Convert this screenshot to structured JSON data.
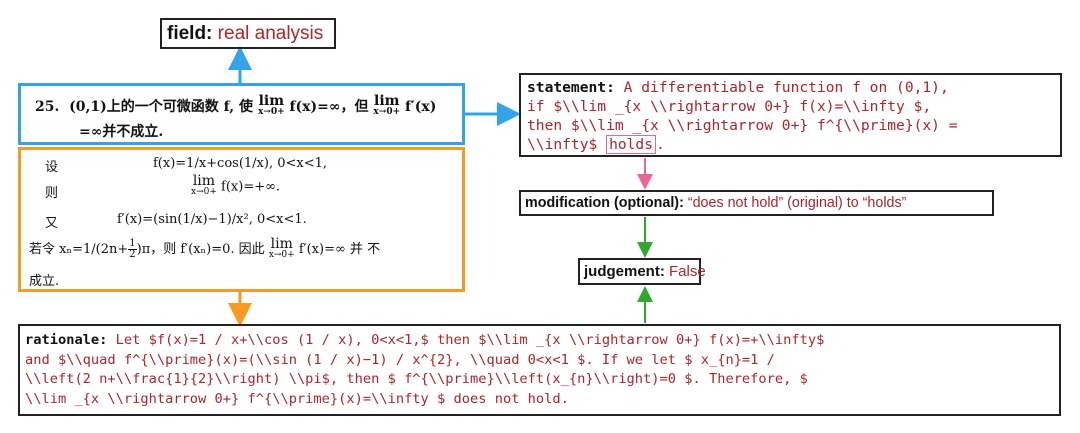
{
  "field": {
    "label": "field:",
    "value": "real analysis"
  },
  "problem": {
    "number": "25.",
    "line1_a": "(0,1)上的一个可微函数 f, 使",
    "lim1_top": "lim",
    "lim1_sub": "x→0+",
    "line1_b": "f(x)=∞，但",
    "lim2_top": "lim",
    "lim2_sub": "x→0+",
    "line1_c": "f′(x)",
    "line2": "=∞并不成立."
  },
  "solution": {
    "r1_word": "设",
    "r1_expr": "f(x)=1/x+cos(1/x), 0<x<1,",
    "r2_word": "则",
    "r2_lim": "lim",
    "r2_sub": "x→0+",
    "r2_expr": "f(x)=+∞.",
    "r3_word": "又",
    "r3_expr": "f′(x)=(sin(1/x)−1)/x²,   0<x<1.",
    "r4_a": "若令 xₙ=1/(2n+",
    "r4_frac_n": "1",
    "r4_frac_d": "2",
    "r4_b": ")π，则 f′(xₙ)=0. 因此",
    "r4_lim": "lim",
    "r4_sub": "x→0+",
    "r4_c": "f′(x)=∞ 并 不",
    "r5": "成立."
  },
  "statement": {
    "label": "statement:",
    "line1": " A differentiable function f on (0,1),",
    "line2": "if $\\\\lim _{x \\\\rightarrow 0+} f(x)=\\\\infty $,",
    "line3": "then $\\\\lim _{x \\\\rightarrow 0+} f^{\\\\prime}(x) =",
    "line4_a": "\\\\infty$ ",
    "line4_highlight": "holds",
    "line4_b": "."
  },
  "modification": {
    "label": "modification (optional):",
    "value": " “does not hold” (original)  to “holds”"
  },
  "judgement": {
    "label": "judgement:",
    "value": " False"
  },
  "rationale": {
    "label": "rationale:",
    "line1": " Let $f(x)=1 / x+\\\\cos (1 / x), 0<x<1,$ then $\\\\lim _{x \\\\rightarrow 0+} f(x)=+\\\\infty$",
    "line2": "and $\\\\quad f^{\\\\prime}(x)=(\\\\sin (1 / x)−1) / x^{2}, \\\\quad 0<x<1 $. If we let $ x_{n}=1 /",
    "line3": "\\\\left(2 n+\\\\frac{1}{2}\\\\right) \\\\pi$, then $ f^{\\\\prime}\\\\left(x_{n}\\\\right)=0 $. Therefore, $",
    "line4": "\\\\lim _{x \\\\rightarrow 0+} f^{\\\\prime}(x)=\\\\infty $ does not hold."
  },
  "colors": {
    "value_red": "#a8262c",
    "problem_border": "#33a4e6",
    "solution_border": "#f59b22",
    "highlight_pink": "#e8698f",
    "green_arrow": "#2fa82f"
  }
}
